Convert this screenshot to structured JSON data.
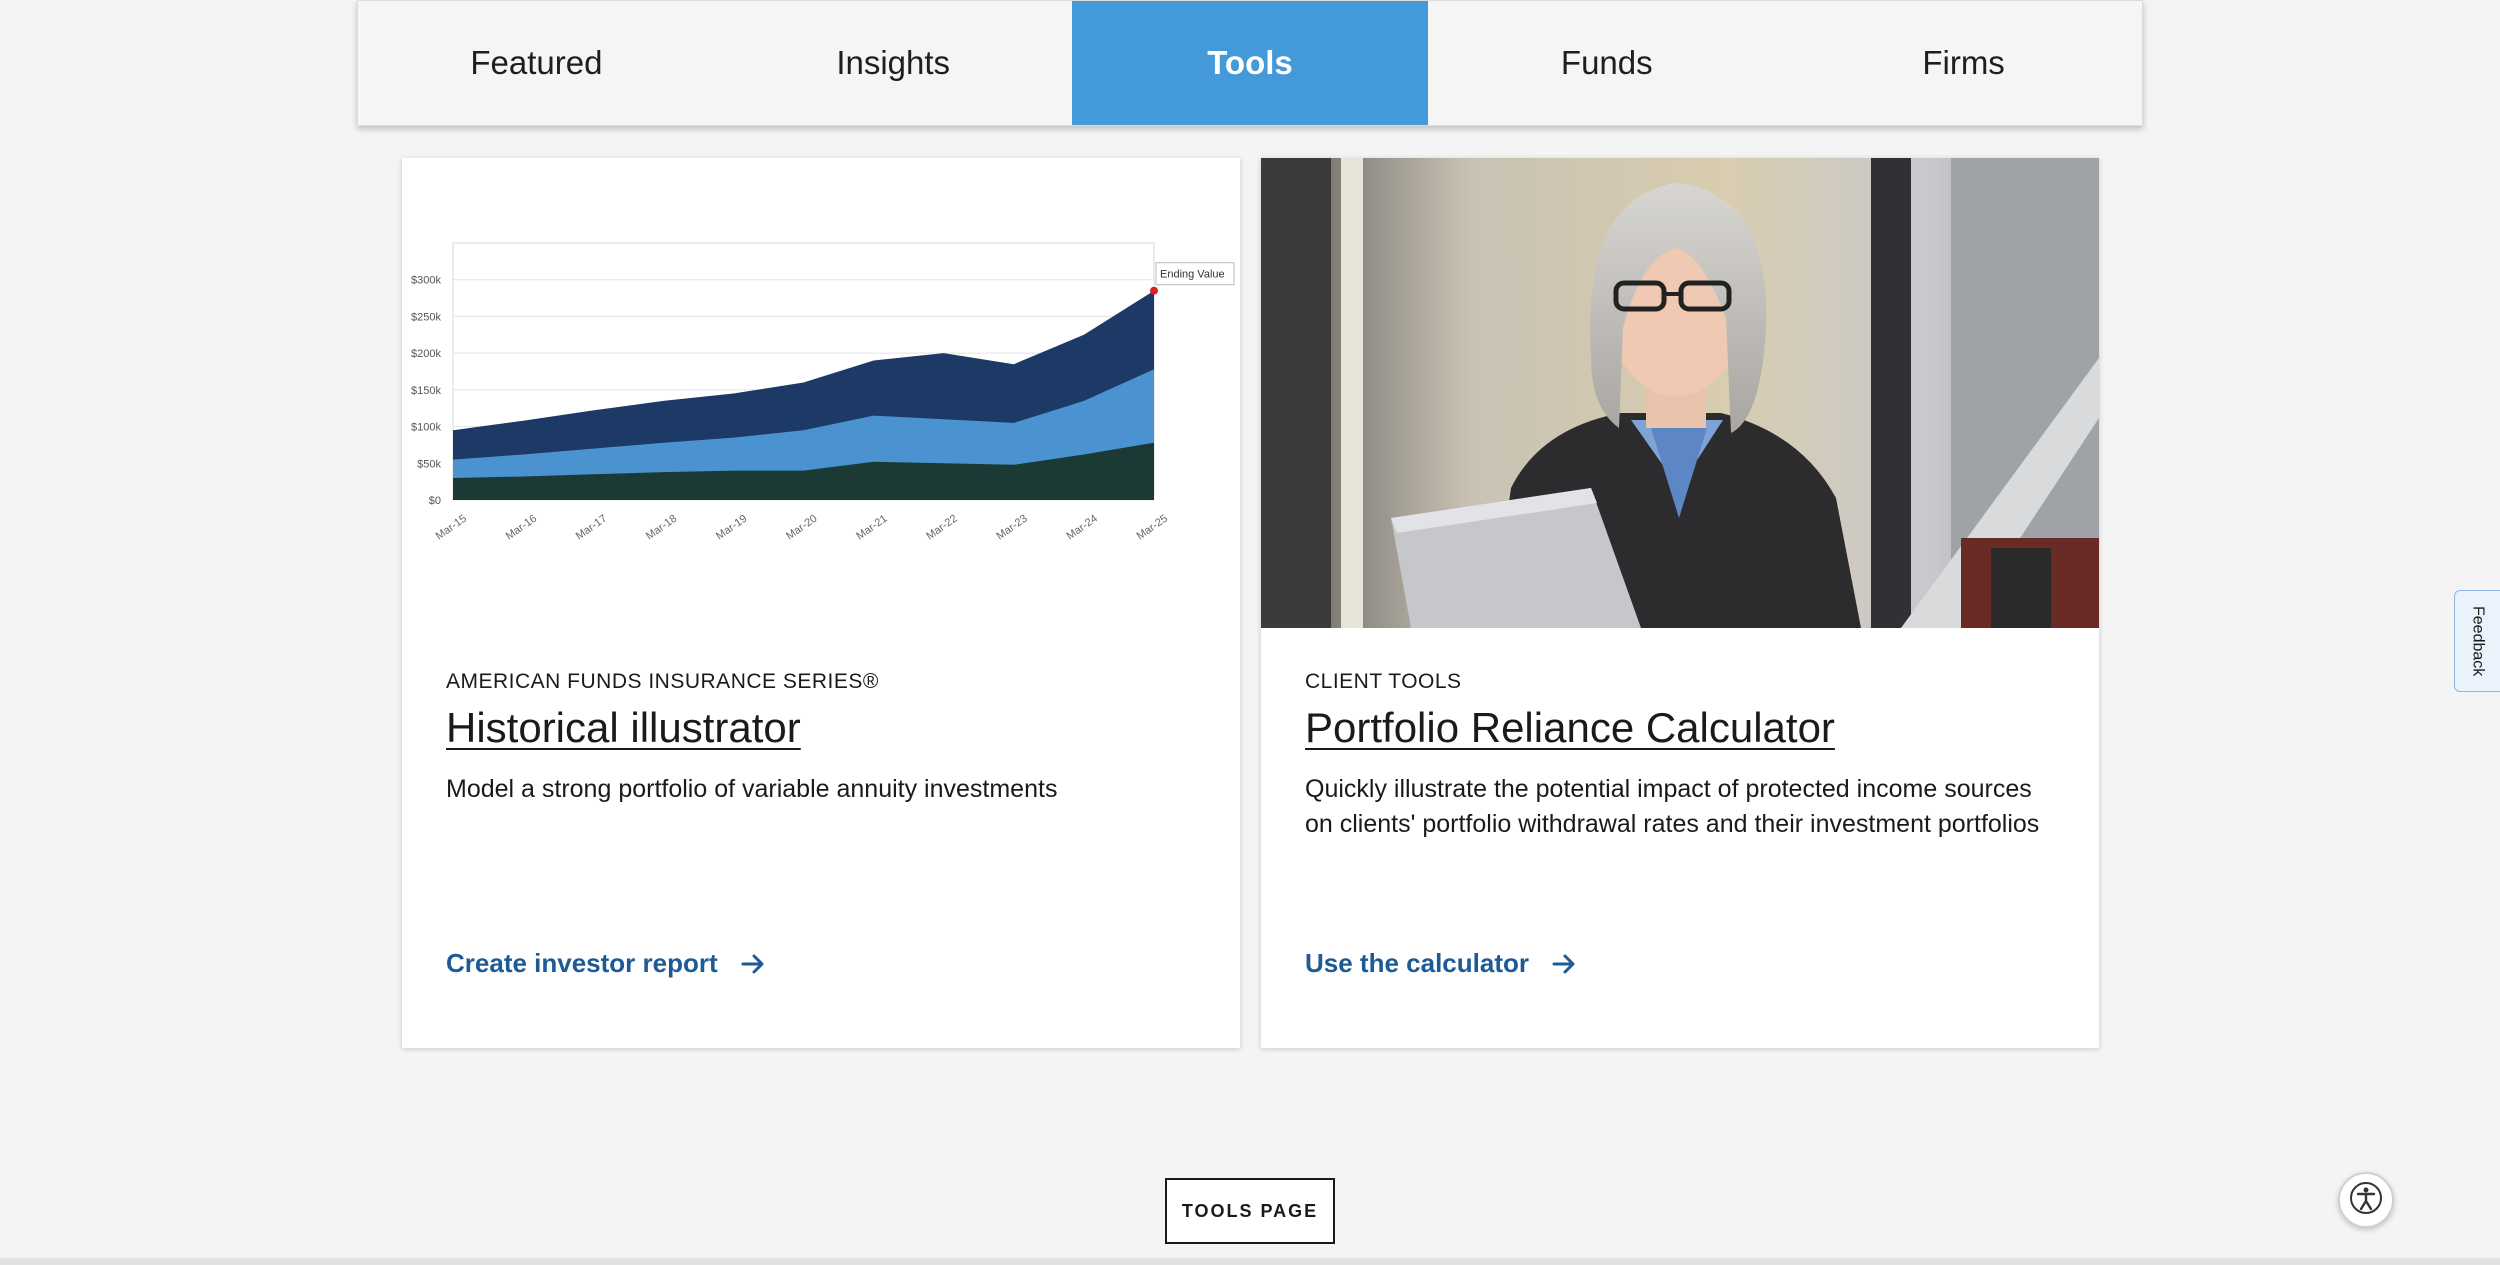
{
  "tabs": [
    {
      "label": "Featured",
      "active": false
    },
    {
      "label": "Insights",
      "active": false
    },
    {
      "label": "Tools",
      "active": true
    },
    {
      "label": "Funds",
      "active": false
    },
    {
      "label": "Firms",
      "active": false
    }
  ],
  "cards": [
    {
      "eyebrow": "AMERICAN FUNDS INSURANCE SERIES®",
      "title": "Historical illustrator",
      "description": "Model a strong portfolio of variable annuity investments",
      "cta": "Create investor report"
    },
    {
      "eyebrow": "CLIENT TOOLS",
      "title": "Portfolio Reliance Calculator",
      "description": "Quickly illustrate the potential impact of protected income sources on clients' portfolio withdrawal rates and their investment portfolios",
      "cta": "Use the calculator"
    }
  ],
  "chart_data": {
    "type": "area",
    "x": [
      "Mar-15",
      "Mar-16",
      "Mar-17",
      "Mar-18",
      "Mar-19",
      "Mar-20",
      "Mar-21",
      "Mar-22",
      "Mar-23",
      "Mar-24",
      "Mar-25"
    ],
    "series": [
      {
        "values": [
          30,
          32,
          35,
          38,
          40,
          40,
          52,
          50,
          48,
          62,
          78
        ],
        "color": "#1b3a35"
      },
      {
        "values": [
          55,
          62,
          70,
          78,
          85,
          95,
          115,
          110,
          105,
          135,
          178
        ],
        "color": "#4a93d0"
      },
      {
        "values": [
          95,
          108,
          122,
          135,
          145,
          160,
          190,
          200,
          185,
          225,
          285
        ],
        "color": "#1d3966"
      }
    ],
    "yticks": [
      "$0",
      "$50k",
      "$100k",
      "$150k",
      "$200k",
      "$250k",
      "$300k"
    ],
    "ylim": [
      0,
      350
    ],
    "annotation": "Ending Value",
    "grid": true
  },
  "tools_button": "TOOLS PAGE",
  "feedback": "Feedback"
}
